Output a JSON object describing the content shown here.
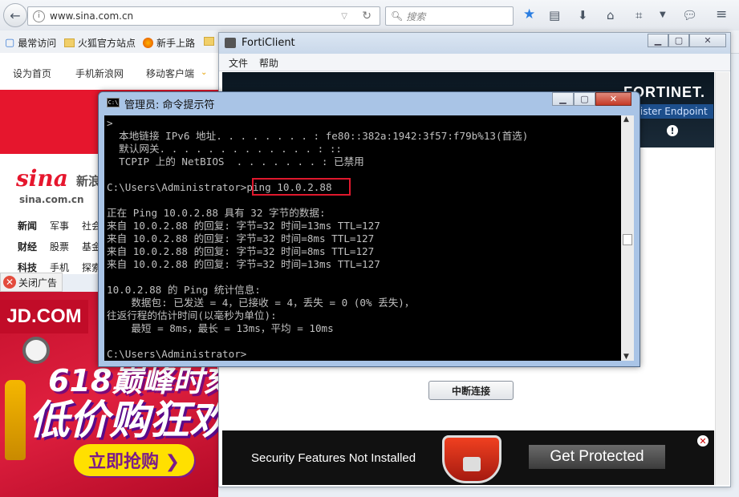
{
  "browser": {
    "url": "www.sina.com.cn",
    "search_placeholder": "搜索",
    "bookmarks": [
      "最常访问",
      "火狐官方站点",
      "新手上路"
    ]
  },
  "sina": {
    "top_links": [
      "设为首页",
      "手机新浪网",
      "移动客户端"
    ],
    "logo": "sina",
    "logo_cn": "新浪网",
    "domain": "sina.com.cn",
    "nav_row1": [
      "新闻",
      "军事",
      "社会"
    ],
    "nav_row2": [
      "财经",
      "股票",
      "基金"
    ],
    "nav_row3": [
      "科技",
      "手机",
      "探索"
    ],
    "close_ad": "关闭广告",
    "ad": {
      "brand": "JD.COM",
      "line1": "618巅峰时刻",
      "line2": "低价购狂欢",
      "button": "立即抢购 ❯"
    }
  },
  "forticlient": {
    "title": "FortiClient",
    "menu": [
      "文件",
      "帮助"
    ],
    "brand": "FORTINET.",
    "register_button": "gister Endpoint",
    "disconnect_button": "中断连接",
    "banner_text": "Security Features Not Installed",
    "get_protected": "Get Protected"
  },
  "cmd": {
    "title": "管理员: 命令提示符",
    "lines": [
      ">",
      "  本地链接 IPv6 地址. . . . . . . . : fe80::382a:1942:3f57:f79b%13(首选)",
      "  默认网关. . . . . . . . . . . . . : ::",
      "  TCPIP 上的 NetBIOS  . . . . . . . : 已禁用",
      "",
      "C:\\Users\\Administrator>ping 10.0.2.88",
      "",
      "正在 Ping 10.0.2.88 具有 32 字节的数据:",
      "来自 10.0.2.88 的回复: 字节=32 时间=13ms TTL=127",
      "来自 10.0.2.88 的回复: 字节=32 时间=8ms TTL=127",
      "来自 10.0.2.88 的回复: 字节=32 时间=8ms TTL=127",
      "来自 10.0.2.88 的回复: 字节=32 时间=13ms TTL=127",
      "",
      "10.0.2.88 的 Ping 统计信息:",
      "    数据包: 已发送 = 4，已接收 = 4，丢失 = 0 (0% 丢失)，",
      "往返行程的估计时间(以毫秒为单位):",
      "    最短 = 8ms，最长 = 13ms，平均 = 10ms",
      "",
      "C:\\Users\\Administrator>"
    ]
  }
}
